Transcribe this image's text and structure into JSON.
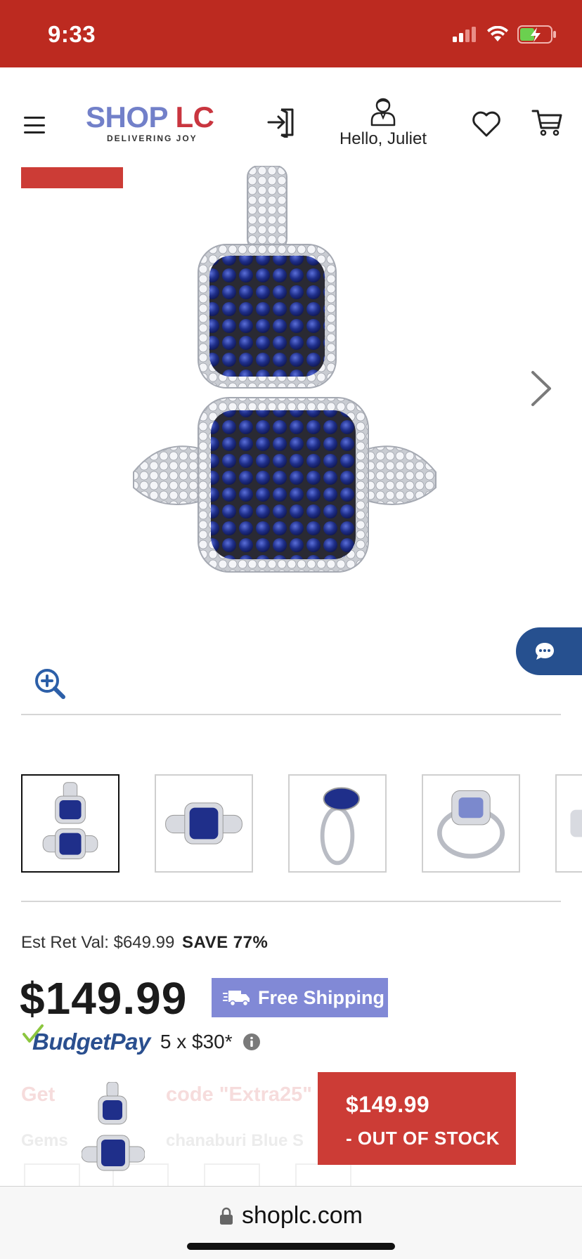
{
  "status_bar": {
    "time": "9:33"
  },
  "header": {
    "logo_main_shop": "SHOP",
    "logo_main_lc": "LC",
    "logo_tagline": "DELIVERING JOY",
    "account_label": "Hello, Juliet"
  },
  "thumbnails": [
    {
      "name": "pendant-and-ring-set",
      "active": true
    },
    {
      "name": "ring-front-view",
      "active": false
    },
    {
      "name": "ring-side-view",
      "active": false
    },
    {
      "name": "ring-back-view",
      "active": false
    },
    {
      "name": "more-views",
      "active": false
    }
  ],
  "pricing": {
    "est_ret_label": "Est Ret Val: $649.99",
    "save_label": "SAVE 77%",
    "price": "$149.99",
    "free_shipping_label": "Free Shipping",
    "budgetpay_label": "BudgetPay",
    "budgetpay_amount": "5 x $30*"
  },
  "faded_content": {
    "promo_start": "Get",
    "promo_code": "code \"Extra25\"",
    "gem_label": "Gems",
    "gem_name": "chanaburi Blue S"
  },
  "sticky_bar": {
    "price": "$149.99",
    "status": "- OUT OF STOCK"
  },
  "browser": {
    "url": "shoplc.com"
  },
  "colors": {
    "brand_red": "#bc2a20",
    "button_red": "#cc3c36",
    "free_shipping_purple": "#8189d6",
    "chat_blue": "#26508f",
    "logo_blue": "#7280c9",
    "logo_red": "#c9353f",
    "sapphire_blue": "#1f2f8a"
  }
}
